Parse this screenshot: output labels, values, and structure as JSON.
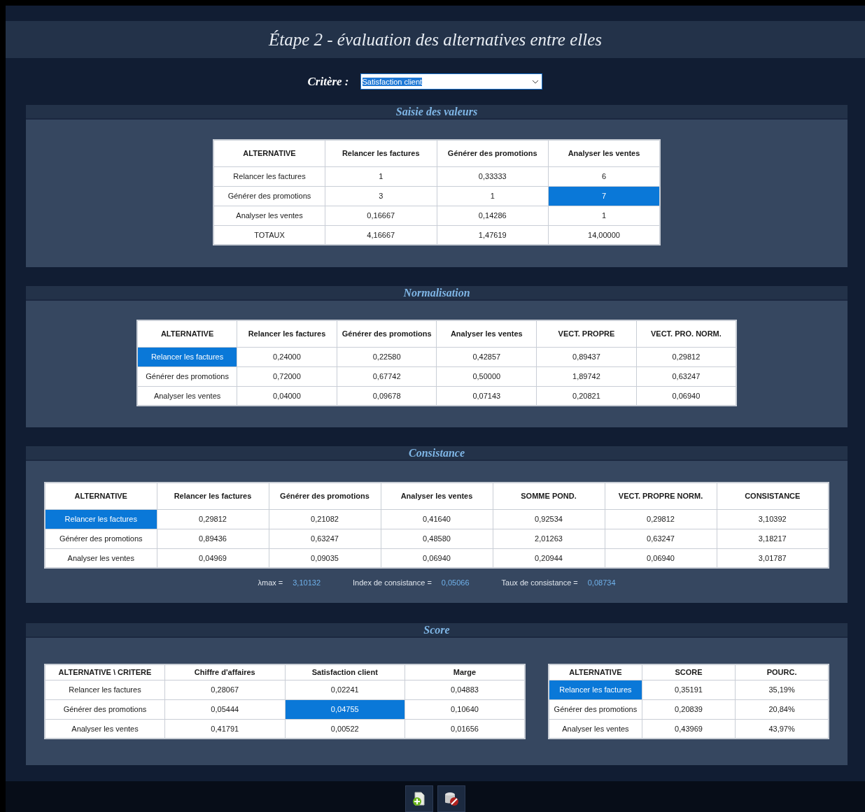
{
  "title": "Étape 2 - évaluation des alternatives entre elles",
  "criterion": {
    "label": "Critère :",
    "value": "Satisfaction client"
  },
  "sections": [
    {
      "title": "Saisie des valeurs",
      "tables": [
        {
          "columns": [
            "ALTERNATIVE",
            "Relancer les factures",
            "Générer des promotions",
            "Analyser les ventes"
          ],
          "rows": [
            [
              {
                "text": "Relancer les factures",
                "selected": false
              },
              {
                "text": "1",
                "selected": false
              },
              {
                "text": "0,33333",
                "selected": false
              },
              {
                "text": "6",
                "selected": false
              }
            ],
            [
              {
                "text": "Générer des promotions",
                "selected": false
              },
              {
                "text": "3",
                "selected": false
              },
              {
                "text": "1",
                "selected": false
              },
              {
                "text": "7",
                "selected": true
              }
            ],
            [
              {
                "text": "Analyser les ventes",
                "selected": false
              },
              {
                "text": "0,16667",
                "selected": false
              },
              {
                "text": "0,14286",
                "selected": false
              },
              {
                "text": "1",
                "selected": false
              }
            ],
            [
              {
                "text": "TOTAUX",
                "selected": false
              },
              {
                "text": "4,16667",
                "selected": false
              },
              {
                "text": "1,47619",
                "selected": false
              },
              {
                "text": "14,00000",
                "selected": false
              }
            ]
          ]
        }
      ]
    },
    {
      "title": "Normalisation",
      "tables": [
        {
          "columns": [
            "ALTERNATIVE",
            "Relancer les factures",
            "Générer des promotions",
            "Analyser les ventes",
            "VECT. PROPRE",
            "VECT. PRO. NORM."
          ],
          "rows": [
            [
              {
                "text": "Relancer les factures",
                "selected": true
              },
              {
                "text": "0,24000",
                "selected": false
              },
              {
                "text": "0,22580",
                "selected": false
              },
              {
                "text": "0,42857",
                "selected": false
              },
              {
                "text": "0,89437",
                "selected": false
              },
              {
                "text": "0,29812",
                "selected": false
              }
            ],
            [
              {
                "text": "Générer des promotions",
                "selected": false
              },
              {
                "text": "0,72000",
                "selected": false
              },
              {
                "text": "0,67742",
                "selected": false
              },
              {
                "text": "0,50000",
                "selected": false
              },
              {
                "text": "1,89742",
                "selected": false
              },
              {
                "text": "0,63247",
                "selected": false
              }
            ],
            [
              {
                "text": "Analyser les ventes",
                "selected": false
              },
              {
                "text": "0,04000",
                "selected": false
              },
              {
                "text": "0,09678",
                "selected": false
              },
              {
                "text": "0,07143",
                "selected": false
              },
              {
                "text": "0,20821",
                "selected": false
              },
              {
                "text": "0,06940",
                "selected": false
              }
            ]
          ]
        }
      ]
    },
    {
      "title": "Consistance",
      "tables": [
        {
          "columns": [
            "ALTERNATIVE",
            "Relancer les factures",
            "Générer des promotions",
            "Analyser les ventes",
            "SOMME POND.",
            "VECT. PROPRE NORM.",
            "CONSISTANCE"
          ],
          "rows": [
            [
              {
                "text": "Relancer les factures",
                "selected": true
              },
              {
                "text": "0,29812",
                "selected": false
              },
              {
                "text": "0,21082",
                "selected": false
              },
              {
                "text": "0,41640",
                "selected": false
              },
              {
                "text": "0,92534",
                "selected": false
              },
              {
                "text": "0,29812",
                "selected": false
              },
              {
                "text": "3,10392",
                "selected": false
              }
            ],
            [
              {
                "text": "Générer des promotions",
                "selected": false
              },
              {
                "text": "0,89436",
                "selected": false
              },
              {
                "text": "0,63247",
                "selected": false
              },
              {
                "text": "0,48580",
                "selected": false
              },
              {
                "text": "2,01263",
                "selected": false
              },
              {
                "text": "0,63247",
                "selected": false
              },
              {
                "text": "3,18217",
                "selected": false
              }
            ],
            [
              {
                "text": "Analyser les ventes",
                "selected": false
              },
              {
                "text": "0,04969",
                "selected": false
              },
              {
                "text": "0,09035",
                "selected": false
              },
              {
                "text": "0,06940",
                "selected": false
              },
              {
                "text": "0,20944",
                "selected": false
              },
              {
                "text": "0,06940",
                "selected": false
              },
              {
                "text": "3,01787",
                "selected": false
              }
            ]
          ]
        }
      ],
      "stats": [
        {
          "label": "λmax =",
          "value": "3,10132"
        },
        {
          "label": "Index de consistance =",
          "value": "0,05066"
        },
        {
          "label": "Taux de consistance =",
          "value": "0,08734"
        }
      ]
    },
    {
      "title": "Score",
      "tables": [
        {
          "columns": [
            "ALTERNATIVE \\ CRITERE",
            "Chiffre d'affaires",
            "Satisfaction client",
            "Marge"
          ],
          "rows": [
            [
              {
                "text": "Relancer les factures",
                "selected": false
              },
              {
                "text": "0,28067",
                "selected": false
              },
              {
                "text": "0,02241",
                "selected": false
              },
              {
                "text": "0,04883",
                "selected": false
              }
            ],
            [
              {
                "text": "Générer des promotions",
                "selected": false
              },
              {
                "text": "0,05444",
                "selected": false
              },
              {
                "text": "0,04755",
                "selected": true
              },
              {
                "text": "0,10640",
                "selected": false
              }
            ],
            [
              {
                "text": "Analyser les ventes",
                "selected": false
              },
              {
                "text": "0,41791",
                "selected": false
              },
              {
                "text": "0,00522",
                "selected": false
              },
              {
                "text": "0,01656",
                "selected": false
              }
            ]
          ]
        },
        {
          "columns": [
            "ALTERNATIVE",
            "SCORE",
            "POURC."
          ],
          "rows": [
            [
              {
                "text": "Relancer les factures",
                "selected": true
              },
              {
                "text": "0,35191",
                "selected": false
              },
              {
                "text": "35,19%",
                "selected": false
              }
            ],
            [
              {
                "text": "Générer des promotions",
                "selected": false
              },
              {
                "text": "0,20839",
                "selected": false
              },
              {
                "text": "20,84%",
                "selected": false
              }
            ],
            [
              {
                "text": "Analyser les ventes",
                "selected": false
              },
              {
                "text": "0,43969",
                "selected": false
              },
              {
                "text": "43,97%",
                "selected": false
              }
            ]
          ]
        }
      ]
    }
  ],
  "footer_buttons": [
    {
      "kind": "add"
    },
    {
      "kind": "delete"
    }
  ]
}
